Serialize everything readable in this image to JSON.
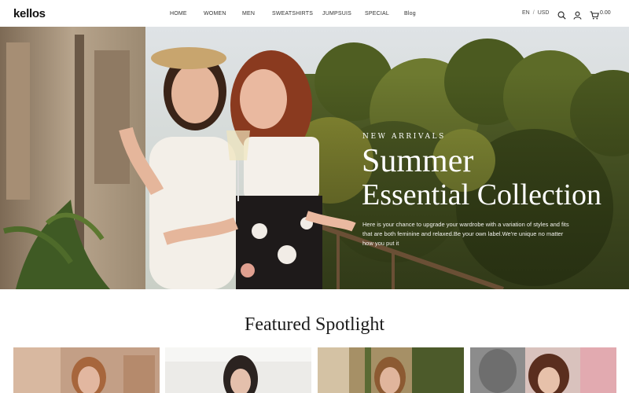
{
  "header": {
    "logo": "kellos",
    "nav": [
      "HOME",
      "WOMEN",
      "MEN",
      "SWEATSHIRTS",
      "JUMPSUIS",
      "SPECIAL",
      "Blog"
    ],
    "language": "EN",
    "separator": "/",
    "currency": "USD",
    "cart_total": "0.00",
    "icons": [
      "search-icon",
      "user-icon",
      "cart-icon"
    ]
  },
  "hero": {
    "eyebrow": "NEW ARRIVALS",
    "title_line1": "Summer",
    "title_line2": "Essential Collection",
    "description": "Here is your chance to upgrade your wardrobe with a variation of styles and fits that are both feminine and relaxed.Be your own label.We're unique no matter how you put it"
  },
  "featured": {
    "title": "Featured Spotlight",
    "cards": [
      "spotlight-card-1",
      "spotlight-card-2",
      "spotlight-card-3",
      "spotlight-card-4"
    ]
  },
  "colors": {
    "accent_text": "#ffffff",
    "foliage": "#5f6b2e",
    "background": "#ffffff"
  }
}
